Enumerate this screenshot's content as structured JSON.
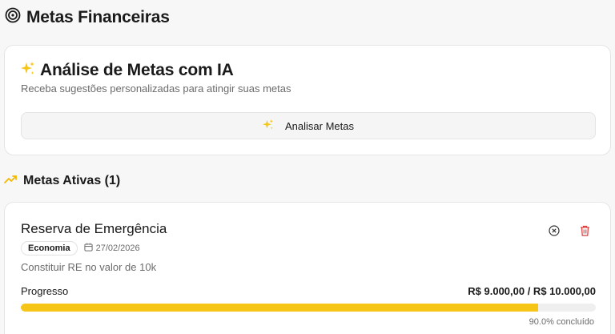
{
  "header": {
    "title": "Metas Financeiras",
    "icon": "target-icon"
  },
  "ai_card": {
    "icon": "sparkles-icon",
    "title": "Análise de Metas com IA",
    "subtitle": "Receba sugestões personalizadas para atingir suas metas",
    "button_label": "Analisar Metas"
  },
  "active_goals": {
    "icon": "trending-up-icon",
    "title": "Metas Ativas (1)"
  },
  "goals": [
    {
      "name": "Reserva de Emergência",
      "category": "Economia",
      "date": "27/02/2026",
      "description": "Constituir RE no valor de 10k",
      "progress_label": "Progresso",
      "amount": "R$ 9.000,00 / R$ 10.000,00",
      "progress_fraction": 0.9,
      "percent_text": "90.0% concluído"
    }
  ],
  "colors": {
    "accent": "#f5c518",
    "danger": "#d83a3a",
    "muted": "#6b6b6b"
  }
}
